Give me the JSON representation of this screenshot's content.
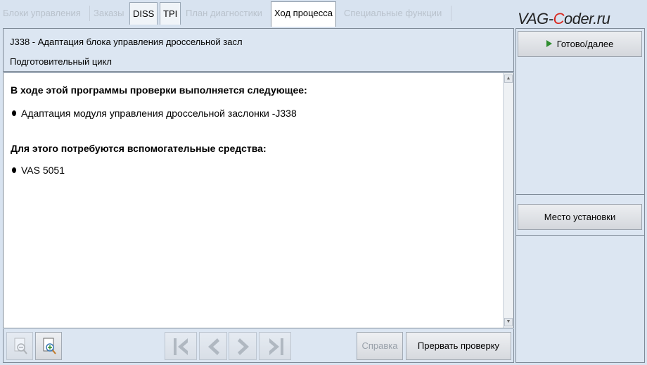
{
  "tabs": [
    {
      "label": "Блоки управления",
      "state": "disabled"
    },
    {
      "label": "Заказы",
      "state": "disabled"
    },
    {
      "label": "DISS",
      "state": "enabled"
    },
    {
      "label": "TPI",
      "state": "enabled"
    },
    {
      "label": "План диагностики",
      "state": "disabled"
    },
    {
      "label": "Ход процесса",
      "state": "active"
    },
    {
      "label": "Специальные функции",
      "state": "disabled"
    }
  ],
  "watermark": {
    "prefix": "VAG-",
    "accent": "C",
    "suffix": "oder.ru"
  },
  "header": {
    "title": "J338 - Адаптация блока управления дроссельной засл",
    "subtitle": "Подготовительный цикл"
  },
  "content": {
    "heading1": "В ходе этой программы проверки выполняется следующее:",
    "bullet1": "Адаптация модуля управления дроссельной заслонки -J338",
    "heading2": "Для этого потребуются вспомогательные средства:",
    "bullet2": "VAS 5051"
  },
  "side": {
    "next_label": "Готово/далее",
    "location_label": "Место установки"
  },
  "toolbar": {
    "help_label": "Справка",
    "abort_label": "Прервать проверку"
  },
  "colors": {
    "accent_arrow": "#2f8d2f",
    "watermark_accent": "#d9261c"
  }
}
